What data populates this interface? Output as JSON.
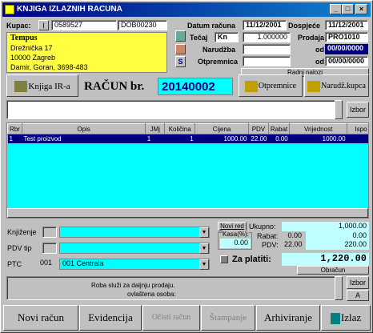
{
  "window": {
    "title": "KNJIGA IZLAZNIH RACUNA",
    "min": "_",
    "max": "□",
    "close": "×"
  },
  "header": {
    "kupac_label": "Kupac:",
    "kupac_btn": "I",
    "kupac_code": "0589527",
    "kupac_code2": "DOB00230",
    "customer_name": "Tempus",
    "customer_street": "Drežnička 17",
    "customer_city": "10000 Zagreb",
    "customer_contact": "Damir, Goran, 3698-483",
    "datum_label": "Datum računa",
    "datum_value": "11/12/2001",
    "dospijece_label": "Dospjeće",
    "dospijece_value": "11/12/2001",
    "tecaj_label": "Tečaj",
    "tecaj_currency": "Kn",
    "tecaj_value": "1.000000",
    "prodaja_label": "Prodaja",
    "prodaja_value": "PRO1010",
    "narudzba_label": "Narudžba",
    "od_label": "od",
    "narudzba_date": "00/00/0000",
    "otpremnica_label": "Otpremnica",
    "otpremnica_date": "00/00/0000",
    "radni_nalozi": "Radni nalozi",
    "s_btn": "S"
  },
  "toolbar": {
    "knjiga_label": "Knjiga IR-a",
    "racun_label": "RAČUN br.",
    "racun_number": "20140002",
    "otpremnice_label": "Otpremnice",
    "narudz_label": "Narudž.kupca",
    "izbor_label": "Izbor"
  },
  "table": {
    "columns": [
      "Rbr",
      "Opis",
      "JMj",
      "Količina",
      "Cijena",
      "PDV",
      "Rabat",
      "Vrijednost",
      "Ispo"
    ],
    "rows": [
      [
        "1",
        "Test proizvod",
        "1",
        "1",
        "1000.00",
        "22.00",
        "0.00",
        "1000.00",
        ""
      ]
    ]
  },
  "bottom": {
    "knjizenje_label": "Knjiženje",
    "pdv_label": "PDV tip",
    "ptc_label": "PTC",
    "ptc_code": "001",
    "ptc_value": "001 Centrala",
    "novi_red": "Novi red",
    "ukupno_label": "Ukupno:",
    "ukupno_value": "1,000.00",
    "kasa_label": "Kasa(%):",
    "kasa_value": "0.00",
    "rabat_label": "Rabat:",
    "rabat_pct": "0.00",
    "rabat_value": "0.00",
    "pdv_sum_label": "PDV:",
    "pdv_pct": "22.00",
    "pdv_value": "220.00",
    "za_platiti_label": "Za platiti:",
    "za_platiti_value": "1,220.00",
    "obracun": "Obračun",
    "note_line1": "Roba služi za daljnju prodaju.",
    "note_line2": "ovlaštena osoba:",
    "izbor2": "Izbor",
    "a_btn": "A"
  },
  "actions": {
    "novi": "Novi račun",
    "evidencija": "Evidencija",
    "ocisti": "Očisti račun",
    "stampanje": "Štampanje",
    "arhiviranje": "Arhiviranje",
    "izlaz": "Izlaz"
  },
  "colors": {
    "titlebar": "#000080",
    "customer_bg": "#ffff40",
    "racun_number_bg": "#00ffff",
    "highlight": "#000080",
    "za_platiti_bg": "#c0ffff"
  }
}
